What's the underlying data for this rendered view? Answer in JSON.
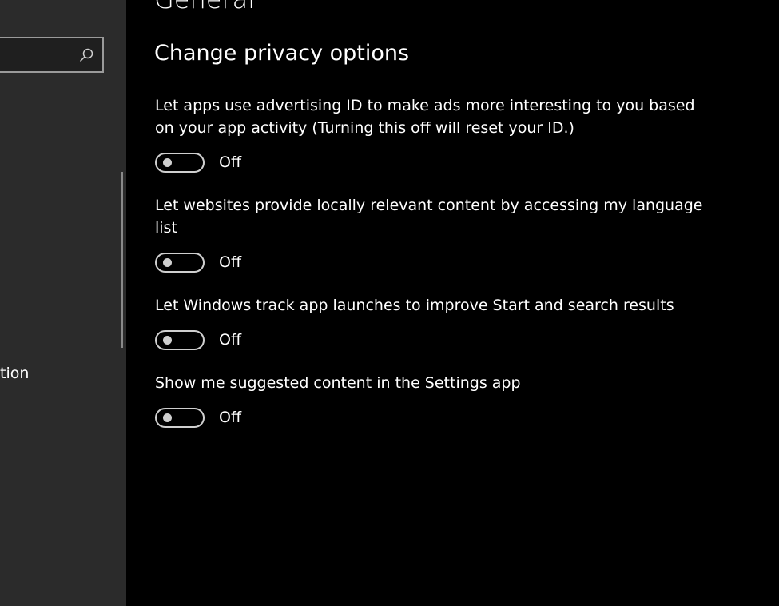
{
  "sidebar": {
    "search_icon": "search-icon",
    "partial_item_label": "tion"
  },
  "main": {
    "page_title": "General",
    "section_title": "Change privacy options",
    "options": [
      {
        "label": "Let apps use advertising ID to make ads more interesting to you based on your app activity (Turning this off will reset your ID.)",
        "state": "Off"
      },
      {
        "label": "Let websites provide locally relevant content by accessing my language list",
        "state": "Off"
      },
      {
        "label": "Let Windows track app launches to improve Start and search results",
        "state": "Off"
      },
      {
        "label": "Show me suggested content in the Settings app",
        "state": "Off"
      }
    ]
  },
  "colors": {
    "sidebar_bg": "#2b2b2b",
    "main_bg": "#000000",
    "toggle_off": "#cfcfcf",
    "text": "#ffffff"
  }
}
